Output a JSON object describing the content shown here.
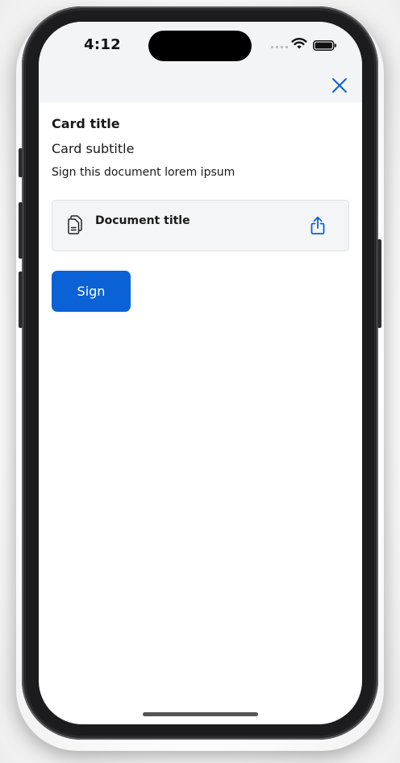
{
  "status_bar": {
    "time": "4:12",
    "icons": [
      "signal-dots-icon",
      "wifi-icon",
      "battery-icon"
    ]
  },
  "nav": {
    "close_icon": "close-icon"
  },
  "card": {
    "title": "Card title",
    "subtitle": "Card subtitle",
    "body": "Sign this document lorem ipsum"
  },
  "document": {
    "icon": "document-icon",
    "title": "Document title",
    "action_icon": "share-icon"
  },
  "actions": {
    "sign_label": "Sign"
  },
  "colors": {
    "accent": "#0b62d6",
    "header_bg": "#f3f4f5",
    "doc_card_bg": "#f4f5f6",
    "text": "#1a1a1a"
  }
}
